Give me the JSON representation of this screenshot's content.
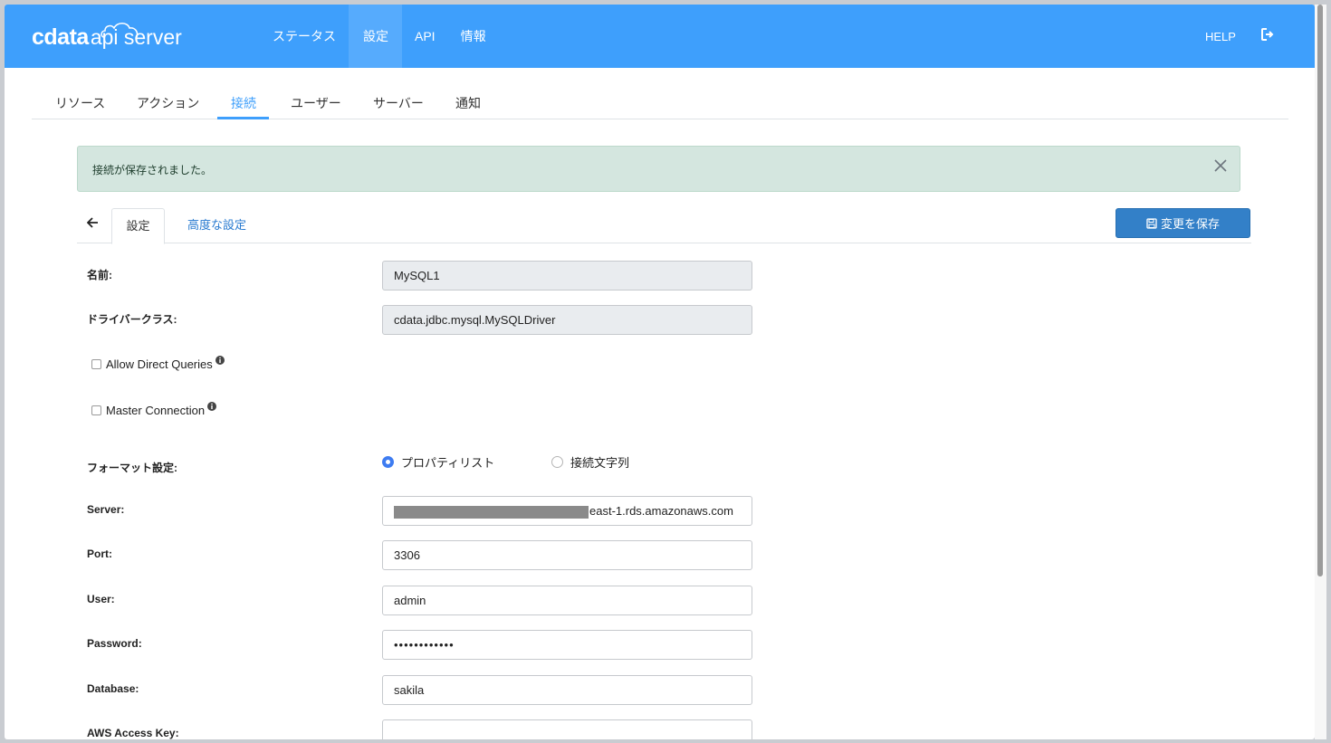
{
  "header": {
    "logo_brand": "cdata",
    "logo_product": "api server",
    "nav": [
      "ステータス",
      "設定",
      "API",
      "情報"
    ],
    "help_label": "HELP",
    "logout_icon": "logout-icon"
  },
  "subnav": {
    "items": [
      "リソース",
      "アクション",
      "接続",
      "ユーザー",
      "サーバー",
      "通知"
    ],
    "active": "接続"
  },
  "alert": {
    "message": "接続が保存されました。",
    "close_icon": "close-icon"
  },
  "tabs": {
    "settings": "設定",
    "advanced": "高度な設定",
    "save_button": "変更を保存"
  },
  "form": {
    "name_label": "名前:",
    "name_value": "MySQL1",
    "driver_label": "ドライバークラス:",
    "driver_value": "cdata.jdbc.mysql.MySQLDriver",
    "allow_direct_queries": "Allow Direct Queries",
    "allow_direct_queries_checked": false,
    "master_connection": "Master Connection",
    "master_connection_checked": false,
    "format_label": "フォーマット設定:",
    "format_options": [
      "プロパティリスト",
      "接続文字列"
    ],
    "format_selected": "プロパティリスト",
    "server_label": "Server:",
    "server_value_visible": "east-1.rds.amazonaws.com",
    "port_label": "Port:",
    "port_value": "3306",
    "user_label": "User:",
    "user_value": "admin",
    "password_label": "Password:",
    "password_value": "••••••••••••",
    "database_label": "Database:",
    "database_value": "sakila",
    "aws_access_key_label": "AWS Access Key:",
    "aws_access_key_value": ""
  },
  "colors": {
    "header": "#3e9ffc",
    "active_nav": "#56abfd",
    "alert_bg": "#d4e6df",
    "save_button": "#3380c8",
    "link": "#2a7bd0"
  }
}
